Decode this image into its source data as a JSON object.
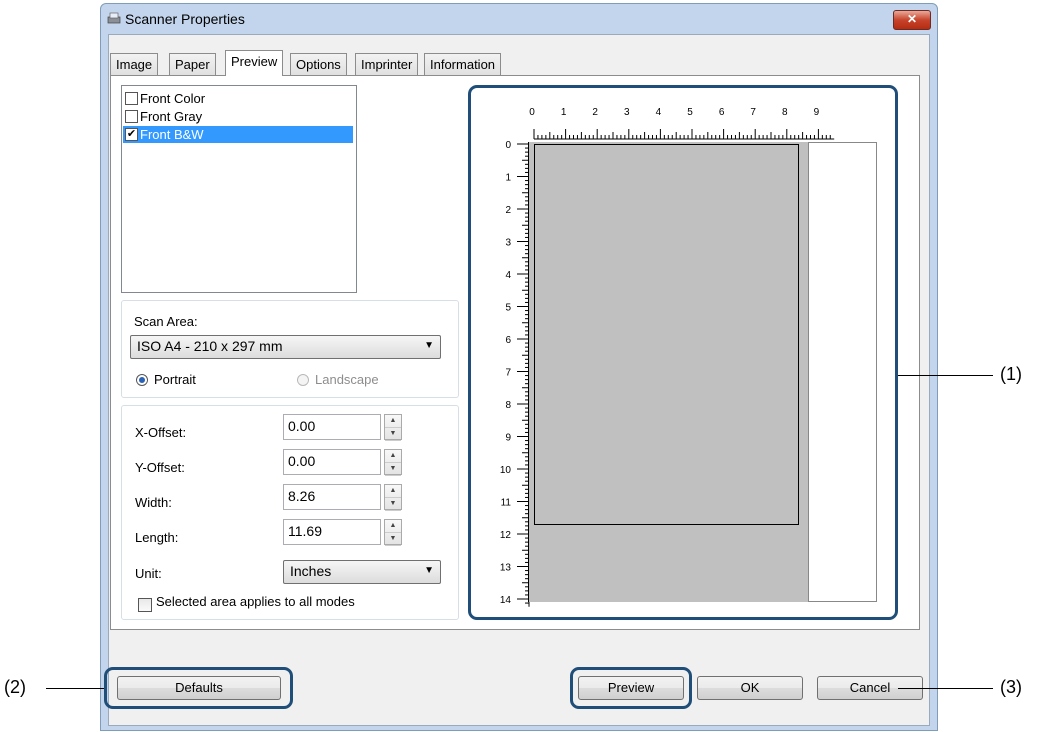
{
  "window": {
    "title": "Scanner Properties",
    "close_glyph": "✕"
  },
  "tabs": [
    {
      "label": "Image",
      "active": false
    },
    {
      "label": "Paper",
      "active": false
    },
    {
      "label": "Preview",
      "active": true
    },
    {
      "label": "Options",
      "active": false
    },
    {
      "label": "Imprinter",
      "active": false
    },
    {
      "label": "Information",
      "active": false
    }
  ],
  "modes": [
    {
      "label": "Front Color",
      "checked": false,
      "selected": false
    },
    {
      "label": "Front Gray",
      "checked": false,
      "selected": false
    },
    {
      "label": "Front B&W",
      "checked": true,
      "selected": true
    }
  ],
  "scan_area": {
    "label": "Scan Area:",
    "value": "ISO A4 - 210 x 297 mm",
    "portrait_label": "Portrait",
    "landscape_label": "Landscape",
    "orientation": "portrait"
  },
  "fields": {
    "x_offset": {
      "label": "X-Offset:",
      "value": "0.00"
    },
    "y_offset": {
      "label": "Y-Offset:",
      "value": "0.00"
    },
    "width": {
      "label": "Width:",
      "value": "8.26"
    },
    "length": {
      "label": "Length:",
      "value": "11.69"
    },
    "unit": {
      "label": "Unit:",
      "value": "Inches"
    },
    "apply_all": {
      "label": "Selected area applies to all modes",
      "checked": false
    }
  },
  "ruler": {
    "horizontal": [
      "0",
      "1",
      "2",
      "3",
      "4",
      "5",
      "6",
      "7",
      "8",
      "9"
    ],
    "vertical": [
      "0",
      "1",
      "2",
      "3",
      "4",
      "5",
      "6",
      "7",
      "8",
      "9",
      "10",
      "11",
      "12",
      "13",
      "14"
    ]
  },
  "buttons": {
    "defaults": "Defaults",
    "preview": "Preview",
    "ok": "OK",
    "cancel": "Cancel"
  },
  "callouts": {
    "c1": "(1)",
    "c2": "(2)",
    "c3": "(3)"
  },
  "colors": {
    "callout_border": "#1f4e79",
    "selection": "#3399ff",
    "preview_bg": "#c0c0c0"
  },
  "icons": {
    "app": "scanner-icon",
    "close": "close-icon",
    "dropdown": "chevron-down-icon",
    "spin_up": "spin-up-icon",
    "spin_down": "spin-down-icon"
  }
}
